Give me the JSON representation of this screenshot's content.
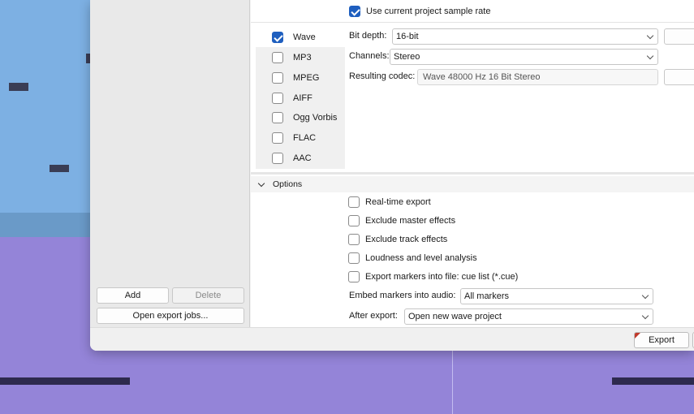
{
  "format_list": [
    {
      "name": "Wave",
      "checked": true
    },
    {
      "name": "MP3",
      "checked": false
    },
    {
      "name": "MPEG",
      "checked": false
    },
    {
      "name": "AIFF",
      "checked": false
    },
    {
      "name": "Ogg Vorbis",
      "checked": false
    },
    {
      "name": "FLAC",
      "checked": false
    },
    {
      "name": "AAC",
      "checked": false
    }
  ],
  "sample_rate": {
    "label": "Use current project sample rate",
    "checked": true
  },
  "settings": {
    "bit_depth_label": "Bit depth:",
    "bit_depth_value": "16-bit",
    "channels_label": "Channels:",
    "channels_value": "Stereo",
    "codec_label": "Resulting codec:",
    "codec_value": "Wave 48000 Hz  16 Bit  Stereo"
  },
  "options": {
    "header": "Options",
    "items": [
      {
        "label": "Real-time export",
        "checked": false
      },
      {
        "label": "Exclude master effects",
        "checked": false
      },
      {
        "label": "Exclude track effects",
        "checked": false
      },
      {
        "label": "Loudness and level analysis",
        "checked": false
      },
      {
        "label": "Export markers into file:  cue list (*.cue)",
        "checked": false
      }
    ],
    "embed_label": "Embed markers into audio:",
    "embed_value": "All markers",
    "after_label": "After export:",
    "after_value": "Open new wave project"
  },
  "left_buttons": {
    "add": "Add",
    "delete": "Delete",
    "open_jobs": "Open export jobs..."
  },
  "footer": {
    "export": "Export"
  },
  "colors": {
    "accent": "#1f5fbf",
    "workspace_blue": "#7db0e3",
    "workspace_purple": "#9484d8"
  }
}
